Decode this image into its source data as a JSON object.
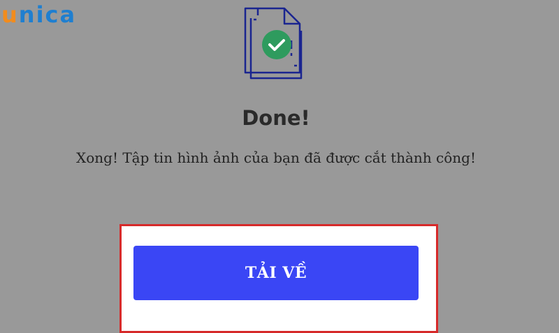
{
  "watermark": {
    "letters": [
      "u",
      "n",
      "i",
      "c",
      "a"
    ]
  },
  "status": {
    "title": "Done!",
    "message": "Xong! Tập tin hình ảnh của bạn đã được cắt thành công!"
  },
  "actions": {
    "download_label": "TẢI VỀ"
  },
  "icons": {
    "document": "document-success-icon",
    "check": "check-icon"
  },
  "colors": {
    "background": "#999999",
    "button": "#3a46f5",
    "highlight": "#d62a2a",
    "check_circle": "#2e9b5e",
    "icon_stroke": "#1a2590",
    "brand_orange": "#f28c1d",
    "brand_blue": "#1f7fd0"
  }
}
